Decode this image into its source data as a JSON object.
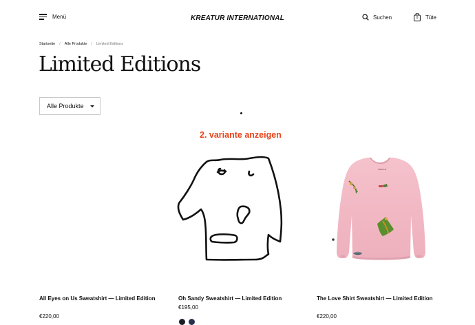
{
  "header": {
    "menu_label": "Menü",
    "brand": "KREATUR INTERNATIONAL",
    "search_label": "Suchen",
    "bag_label": "Tüte",
    "bag_count": "0"
  },
  "breadcrumb": {
    "items": [
      "Startseite",
      "Alle Produkte",
      "Limited Editions"
    ],
    "separator": "/"
  },
  "page_title": "Limited Editions",
  "filter": {
    "selected": "Alle Produkte"
  },
  "annotation": "2. variante anzeigen",
  "products": [
    {
      "name": "All Eyes on Us Sweatshirt — Limited Edition",
      "price": "€220,00"
    },
    {
      "name": "Oh Sandy Sweatshirt — Limited Edition",
      "price": "€195,00",
      "swatches": [
        "#1c1c24",
        "#27304f"
      ]
    },
    {
      "name": "The Love Shirt Sweatshirt — Limited Edition",
      "price": "€220,00"
    }
  ],
  "colors": {
    "annotation": "#e8441b",
    "sweatshirt_pink": "#f2b8c3"
  }
}
